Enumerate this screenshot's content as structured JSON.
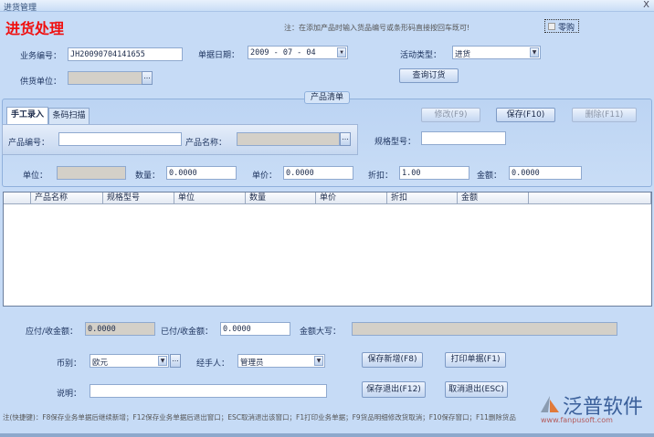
{
  "window": {
    "title": "进货管理",
    "close": "X"
  },
  "header": {
    "title": "进货处理",
    "note": "注：在添加产品时输入货品编号或条形码直接按回车既可!",
    "retail_checkbox": "零购",
    "retail_checked": false
  },
  "form": {
    "business_no_label": "业务编号：",
    "business_no": "JH20090704141655",
    "date_label": "单据日期：",
    "date": "2009 - 07 - 04",
    "activity_label": "活动类型：",
    "activity": "进货",
    "supplier_label": "供货单位：",
    "supplier": "",
    "query_order": "查询订货"
  },
  "product_list": {
    "legend": "产品清单",
    "tabs": [
      {
        "label": "手工录入",
        "active": true
      },
      {
        "label": "条码扫描",
        "active": false
      }
    ],
    "code_label": "产品编号：",
    "code": "",
    "name_label": "产品名称：",
    "name": "",
    "spec_label": "规格型号：",
    "spec": "",
    "edit": "修改(F9)",
    "save": "保存(F10)",
    "delete": "删除(F11)",
    "unit_label": "单位：",
    "unit": "",
    "qty_label": "数量：",
    "qty": "0.0000",
    "price_label": "单价：",
    "price": "0.0000",
    "discount_label": "折扣：",
    "discount": "1.00",
    "amount_label": "金额：",
    "amount": "0.0000"
  },
  "grid": {
    "columns": [
      "产品名称",
      "规格型号",
      "单位",
      "数量",
      "单价",
      "折扣",
      "金额"
    ]
  },
  "bottom": {
    "payable_label": "应付/收金额：",
    "payable": "0.0000",
    "paid_label": "已付/收金额：",
    "paid": "0.0000",
    "words_label": "金额大写：",
    "words": "",
    "currency_label": "币别：",
    "currency": "欧元",
    "handler_label": "经手人：",
    "handler": "管理员",
    "remark_label": "说明：",
    "remark": "",
    "save_new": "保存新增(F8)",
    "print": "打印单据(F1)",
    "save_exit": "保存退出(F12)",
    "cancel_exit": "取消退出(ESC)"
  },
  "footer": {
    "note": "注(快捷键)：F8保存业务单据后继续新增；F12保存业务单据后退出窗口；ESC取消退出该窗口；F1打印业务单据；F9货品明细修改货取消；F10保存窗口；F11删除货品"
  },
  "logo": {
    "name": "泛普软件",
    "url": "www.fanpusoft.com"
  }
}
